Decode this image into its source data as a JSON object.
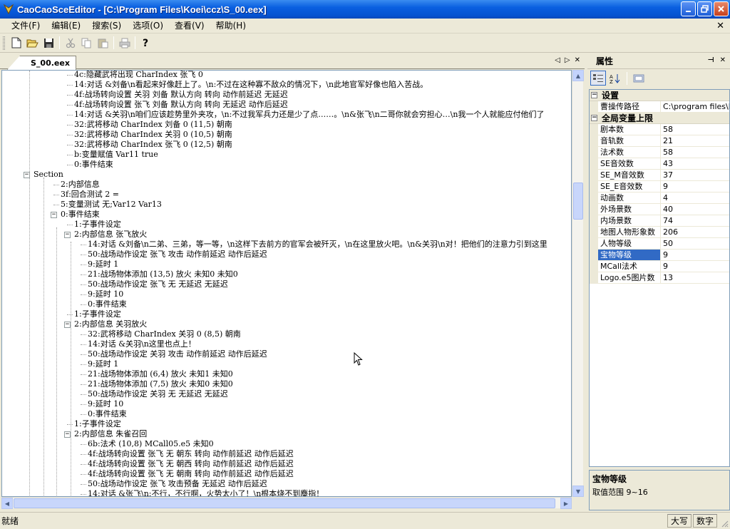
{
  "window": {
    "title": "CaoCaoSceEditor - [C:\\Program Files\\Koei\\ccz\\S_00.eex]"
  },
  "menu": [
    {
      "label": "文件(F)"
    },
    {
      "label": "编辑(E)"
    },
    {
      "label": "搜索(S)"
    },
    {
      "label": "选项(O)"
    },
    {
      "label": "查看(V)"
    },
    {
      "label": "帮助(H)"
    }
  ],
  "toolbar": {
    "buttons": [
      "new-icon",
      "open-icon",
      "save-icon",
      "cut-icon",
      "copy-icon",
      "paste-icon",
      "print-icon",
      "help-icon"
    ]
  },
  "doc_tab": {
    "label": "S_00.eex"
  },
  "tree": [
    {
      "text": "4c:隐藏武将出现 CharIndex 张飞 0",
      "indent": 5
    },
    {
      "text": "14:对话 &刘备\\n看起来好像赶上了。\\n:不过在这种寡不敌众的情况下，\\n此地官军好像也陷入苦战。",
      "indent": 5
    },
    {
      "text": "4f:战场转向设置 关羽 刘备 默认方向 转向 动作前延迟 无延迟",
      "indent": 5
    },
    {
      "text": "4f:战场转向设置 张飞 刘备 默认方向 转向 无延迟 动作后延迟",
      "indent": 5
    },
    {
      "text": "14:对话 &关羽\\n咱们应该趁势里外夹攻，\\n:不过我军兵力还是少了点……。\\n&张飞\\n二哥你就会穷担心…\\n我一个人就能应付他们了",
      "indent": 5
    },
    {
      "text": "32:武将移动 CharIndex 刘备 0 (11,5) 朝南",
      "indent": 5
    },
    {
      "text": "32:武将移动 CharIndex 关羽 0 (10,5) 朝南",
      "indent": 5
    },
    {
      "text": "32:武将移动 CharIndex 张飞 0 (12,5) 朝南",
      "indent": 5
    },
    {
      "text": "b:变量赋值 Var11 true",
      "indent": 5
    },
    {
      "text": "0:事件结束",
      "indent": 5
    },
    {
      "text": "Section",
      "indent": 2,
      "toggle": "-"
    },
    {
      "text": "2:内部信息",
      "indent": 4
    },
    {
      "text": "3f:回合测试 2 =",
      "indent": 4
    },
    {
      "text": "5:变量测试 无;Var12 Var13",
      "indent": 4
    },
    {
      "text": "0:事件结束",
      "indent": 4,
      "toggle": "-"
    },
    {
      "text": "1:子事件设定",
      "indent": 5
    },
    {
      "text": "2:内部信息 张飞放火",
      "indent": 5,
      "toggle": "-"
    },
    {
      "text": "14:对话 &刘备\\n二弟、三弟，等一等，\\n这样下去前方的官军会被歼灭，\\n在这里放火吧。\\n&关羽\\n对！把他们的注意力引到这里",
      "indent": 6
    },
    {
      "text": "50:战场动作设定 张飞 攻击 动作前延迟 动作后延迟",
      "indent": 6
    },
    {
      "text": "9:延时 1",
      "indent": 6
    },
    {
      "text": "21:战场物体添加 (13,5) 放火 未知0 未知0",
      "indent": 6
    },
    {
      "text": "50:战场动作设定 张飞 无 无延迟 无延迟",
      "indent": 6
    },
    {
      "text": "9:延时 10",
      "indent": 6
    },
    {
      "text": "0:事件结束",
      "indent": 6
    },
    {
      "text": "1:子事件设定",
      "indent": 5
    },
    {
      "text": "2:内部信息 关羽放火",
      "indent": 5,
      "toggle": "-"
    },
    {
      "text": "32:武将移动 CharIndex 关羽 0 (8,5) 朝南",
      "indent": 6
    },
    {
      "text": "14:对话 &关羽\\n这里也点上！",
      "indent": 6
    },
    {
      "text": "50:战场动作设定 关羽 攻击 动作前延迟 动作后延迟",
      "indent": 6
    },
    {
      "text": "9:延时 1",
      "indent": 6
    },
    {
      "text": "21:战场物体添加 (6,4) 放火 未知1 未知0",
      "indent": 6
    },
    {
      "text": "21:战场物体添加 (7,5) 放火 未知0 未知0",
      "indent": 6
    },
    {
      "text": "50:战场动作设定 关羽 无 无延迟 无延迟",
      "indent": 6
    },
    {
      "text": "9:延时 10",
      "indent": 6
    },
    {
      "text": "0:事件结束",
      "indent": 6
    },
    {
      "text": "1:子事件设定",
      "indent": 5
    },
    {
      "text": "2:内部信息 朱雀召回",
      "indent": 5,
      "toggle": "-"
    },
    {
      "text": "6b:法术 (10,8) MCall05.e5 未知0",
      "indent": 6
    },
    {
      "text": "4f:战场转向设置 张飞 无 朝东 转向 动作前延迟 动作后延迟",
      "indent": 6
    },
    {
      "text": "4f:战场转向设置 张飞 无 朝西 转向 动作前延迟 动作后延迟",
      "indent": 6
    },
    {
      "text": "4f:战场转向设置 张飞 无 朝南 转向 动作前延迟 动作后延迟",
      "indent": 6
    },
    {
      "text": "50:战场动作设定 张飞 攻击预备 无延迟 动作后延迟",
      "indent": 6
    },
    {
      "text": "14:对话 &张飞\\n:不行，不行啊，火势太小了！\\n根本烧不到麋指！",
      "indent": 6
    }
  ],
  "properties": {
    "title": "属性",
    "categories": [
      {
        "name": "设置",
        "rows": [
          {
            "name": "曹操传路径",
            "value": "C:\\program files\\koei"
          }
        ]
      },
      {
        "name": "全局变量上限",
        "rows": [
          {
            "name": "剧本数",
            "value": "58"
          },
          {
            "name": "音轨数",
            "value": "21"
          },
          {
            "name": "法术数",
            "value": "58"
          },
          {
            "name": "SE音效数",
            "value": "43"
          },
          {
            "name": "SE_M音效数",
            "value": "37"
          },
          {
            "name": "SE_E音效数",
            "value": "9"
          },
          {
            "name": "动画数",
            "value": "4"
          },
          {
            "name": "外场景数",
            "value": "40"
          },
          {
            "name": "内场景数",
            "value": "74"
          },
          {
            "name": "地图人物形象数",
            "value": "206"
          },
          {
            "name": "人物等级",
            "value": "50"
          },
          {
            "name": "宝物等级",
            "value": "9",
            "selected": true
          },
          {
            "name": "MCall法术",
            "value": "9"
          },
          {
            "name": "Logo.e5图片数",
            "value": "13"
          }
        ]
      }
    ],
    "description": {
      "title": "宝物等级",
      "text": "取值范围 9~16"
    }
  },
  "status": {
    "text": "就绪",
    "caps": "大写",
    "num": "数字"
  }
}
